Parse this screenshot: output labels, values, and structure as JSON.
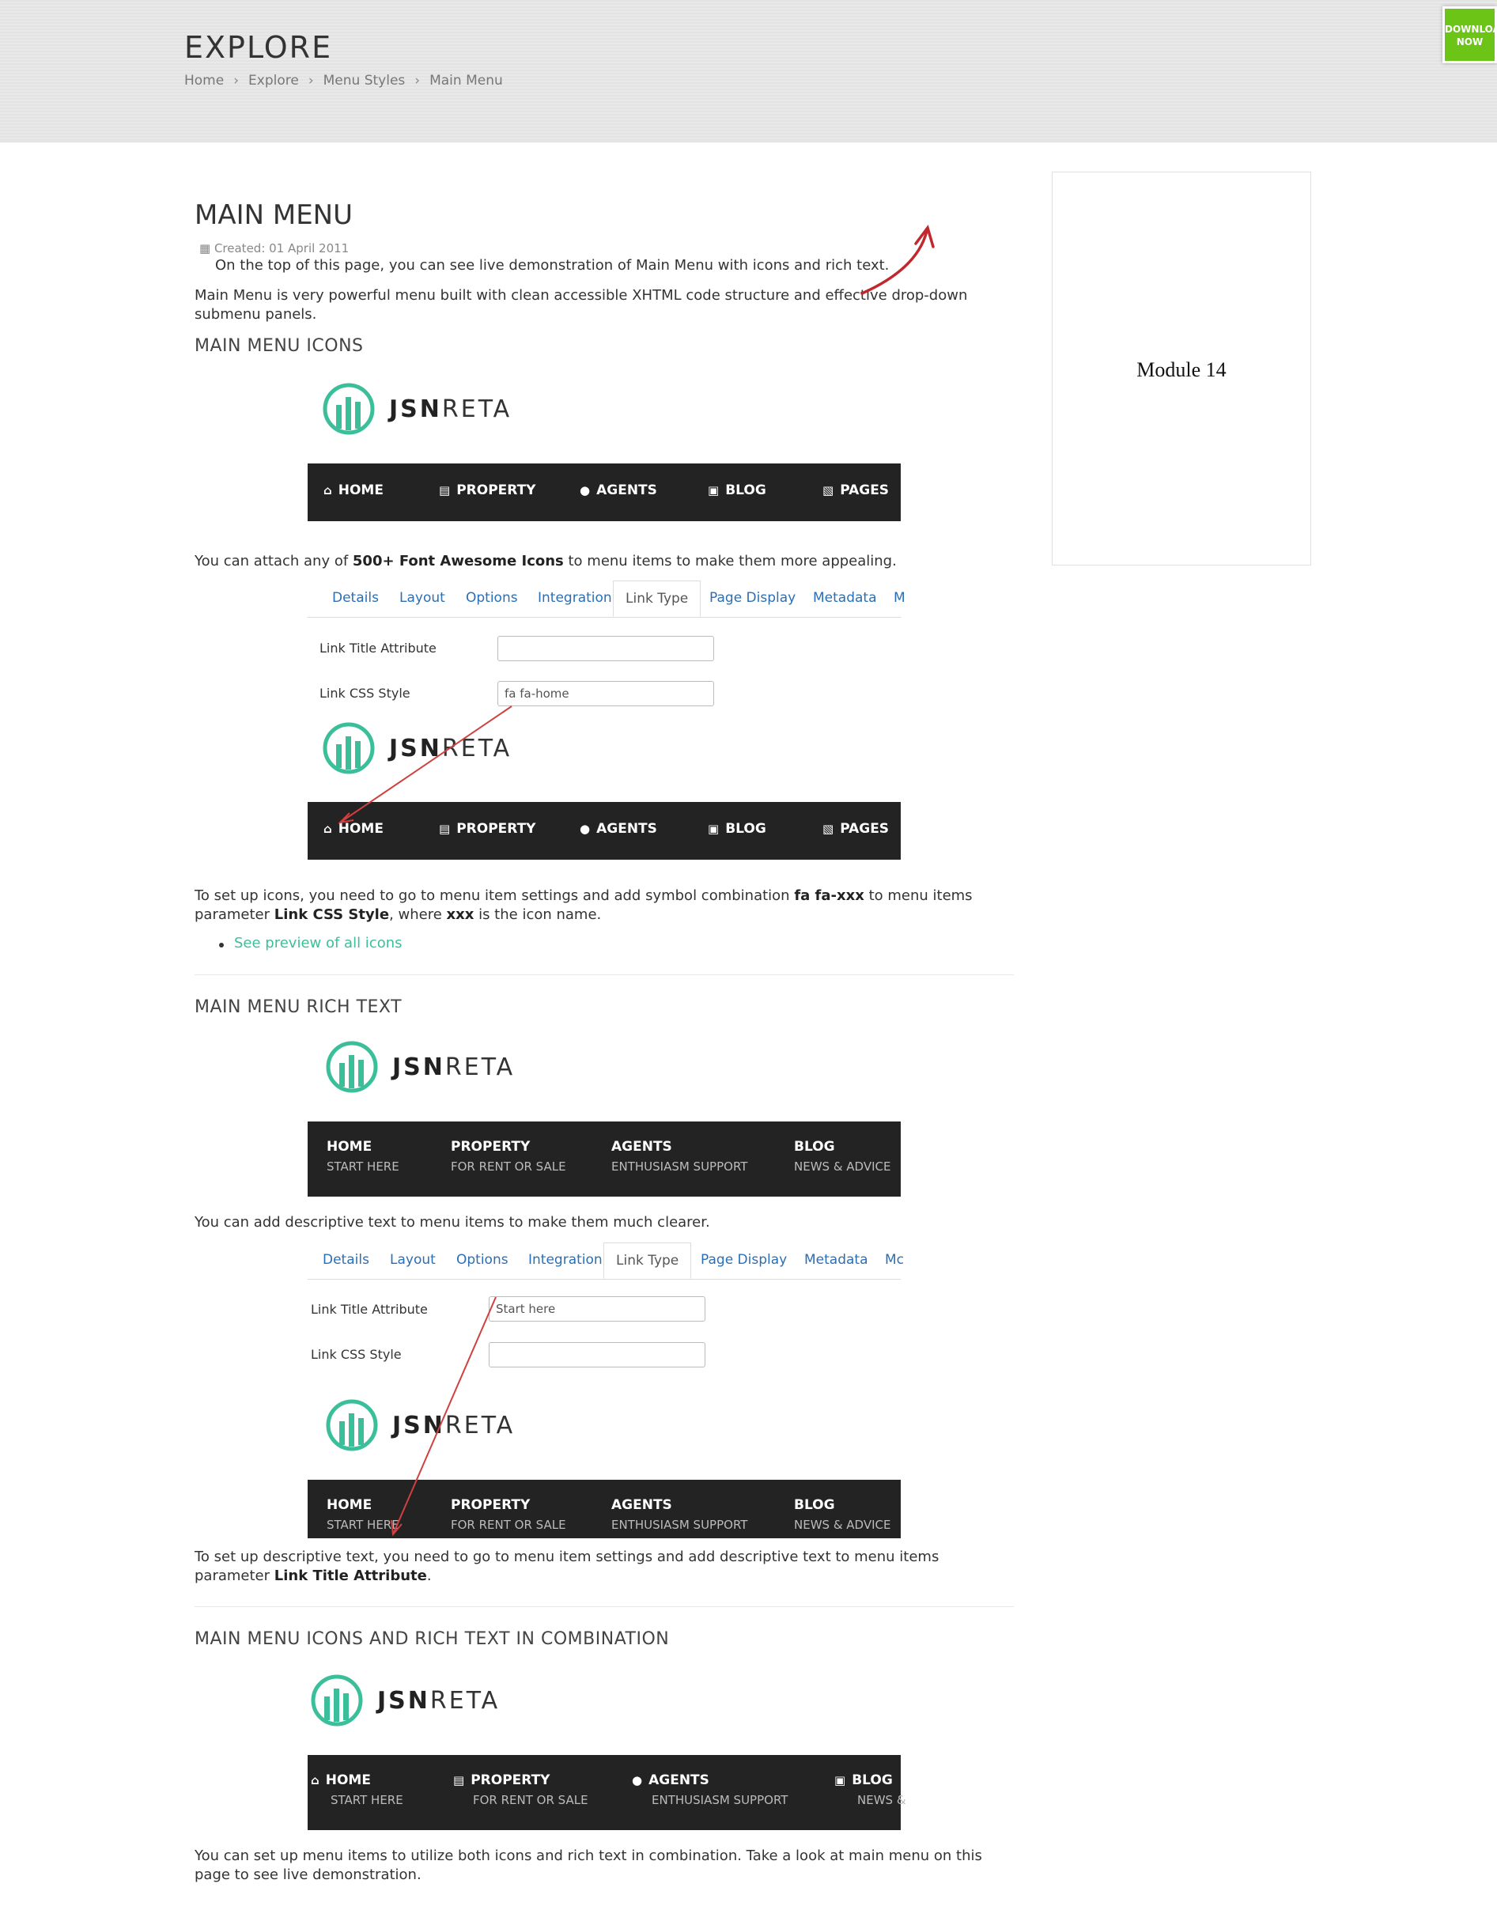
{
  "header": {
    "title": "EXPLORE",
    "breadcrumb": [
      "Home",
      "Explore",
      "Menu Styles",
      "Main Menu"
    ],
    "download_button": [
      "DOWNLOAD",
      "NOW"
    ]
  },
  "sidebar": {
    "module_title": "Module 14"
  },
  "article": {
    "title": "MAIN MENU",
    "created": "Created: 01 April 2011",
    "intro_1": "On the top of this page, you can see live demonstration of Main Menu with icons and rich text.",
    "intro_2": "Main Menu is very powerful menu built with clean accessible XHTML code structure and effective drop-down submenu panels.",
    "section_icons": {
      "heading": "MAIN MENU ICONS",
      "para_1_pre": "You can attach any of ",
      "para_1_bold": "500+ Font Awesome Icons",
      "para_1_post": " to menu items to make them more appealing.",
      "para_2_a": "To set up icons, you need to go to menu item settings and add symbol combination ",
      "para_2_b": "fa fa-xxx",
      "para_2_c": " to menu items parameter ",
      "para_2_d": "Link CSS Style",
      "para_2_e": ", where ",
      "para_2_f": "xxx",
      "para_2_g": " is the icon name.",
      "preview_link": "See preview of all icons"
    },
    "section_rich": {
      "heading": "MAIN MENU RICH TEXT",
      "para_1": "You can add descriptive text to menu items to make them much clearer.",
      "para_2_a": "To set up descriptive text, you need to go to menu item settings and add descriptive text to menu items parameter ",
      "para_2_b": "Link Title Attribute",
      "para_2_c": "."
    },
    "section_combo": {
      "heading": "MAIN MENU ICONS AND RICH TEXT IN COMBINATION",
      "para_1": "You can set up menu items to utilize both icons and rich text in combination. Take a look at main menu on this page to see live demonstration."
    }
  },
  "logo": {
    "bold": "JSN",
    "light": "RETA"
  },
  "menu_icons": [
    "HOME",
    "PROPERTY",
    "AGENTS",
    "BLOG",
    "PAGES"
  ],
  "menu_rich": [
    {
      "label": "HOME",
      "sub": "START HERE"
    },
    {
      "label": "PROPERTY",
      "sub": "FOR RENT OR SALE"
    },
    {
      "label": "AGENTS",
      "sub": "ENTHUSIASM SUPPORT"
    },
    {
      "label": "BLOG",
      "sub": "NEWS & ADVICE"
    }
  ],
  "menu_combo_last_sub": "NEWS &",
  "tabs_1": [
    "Details",
    "Layout",
    "Options",
    "Integration",
    "Link Type",
    "Page Display",
    "Metadata",
    "M"
  ],
  "tabs_2": [
    "Details",
    "Layout",
    "Options",
    "Integration",
    "Link Type",
    "Page Display",
    "Metadata",
    "Mc"
  ],
  "form": {
    "title_label": "Link Title Attribute",
    "css_label": "Link CSS Style",
    "css_value_1": "fa fa-home",
    "title_value_2": "Start here"
  },
  "colors": {
    "accent": "#3bbf9a",
    "menu_bg": "#232323",
    "download": "#6cc417",
    "arrow": "#c0282d"
  }
}
